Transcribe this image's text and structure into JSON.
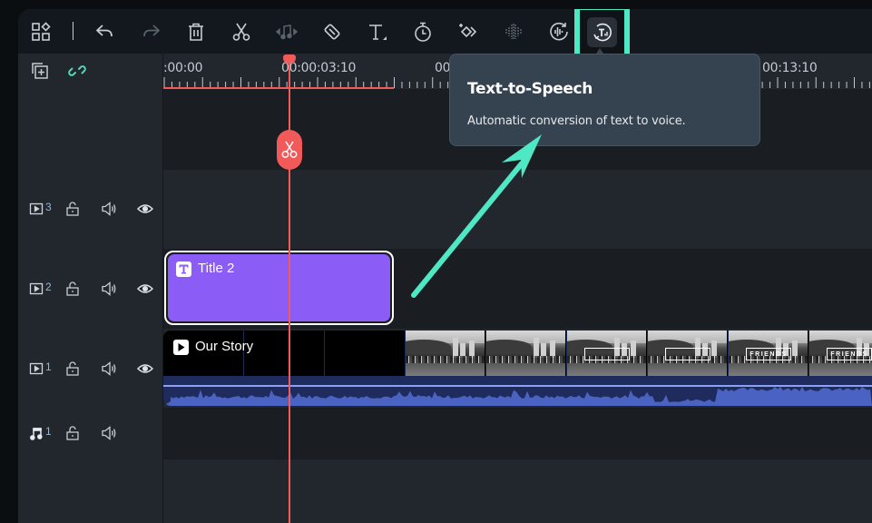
{
  "toolbar": {
    "buttons": [
      {
        "id": "layout",
        "icon": "layout-grid-icon",
        "label": "Layout"
      },
      {
        "id": "undo",
        "icon": "undo-icon",
        "label": "Undo"
      },
      {
        "id": "redo",
        "icon": "redo-icon",
        "label": "Redo",
        "disabled": true
      },
      {
        "id": "delete",
        "icon": "trash-icon",
        "label": "Delete"
      },
      {
        "id": "split",
        "icon": "scissors-icon",
        "label": "Split"
      },
      {
        "id": "audio-stretch",
        "icon": "audio-stretch-icon",
        "label": "Audio Stretch",
        "disabled": true
      },
      {
        "id": "crop",
        "icon": "crop-icon",
        "label": "Crop"
      },
      {
        "id": "text",
        "icon": "text-icon",
        "label": "Text"
      },
      {
        "id": "speed",
        "icon": "timer-icon",
        "label": "Speed"
      },
      {
        "id": "keyframe",
        "icon": "keyframe-icon",
        "label": "Keyframe"
      },
      {
        "id": "audio-detect",
        "icon": "waveform-icon",
        "label": "Silence Detection",
        "disabled": true
      },
      {
        "id": "audio-sync",
        "icon": "audio-sync-icon",
        "label": "Auto Sync"
      },
      {
        "id": "tts",
        "icon": "text-to-speech-icon",
        "label": "Text-to-Speech",
        "highlighted": true
      }
    ]
  },
  "timeline_header": {
    "add_track_icon": "add-track-icon",
    "link_icon": "link-icon"
  },
  "ruler": {
    "labels": [
      ":00:00",
      "00:00:03:10",
      "00",
      "00:13:10"
    ]
  },
  "playhead": {
    "time": "00:00:03:10",
    "color": "#f25a5a"
  },
  "tracks": [
    {
      "type": "video",
      "number": "3",
      "locked": false,
      "muted": false,
      "visible": true
    },
    {
      "type": "video",
      "number": "2",
      "locked": false,
      "muted": false,
      "visible": true
    },
    {
      "type": "video",
      "number": "1",
      "locked": false,
      "muted": false,
      "visible": true
    },
    {
      "type": "audio",
      "number": "1",
      "locked": false,
      "muted": false
    }
  ],
  "clips": {
    "title": {
      "label": "Title 2",
      "color": "#8b5cf6"
    },
    "video": {
      "label": "Our Story",
      "thumb_text": [
        "",
        "",
        "",
        "FRIENDS",
        "FRIENDS"
      ]
    }
  },
  "tooltip": {
    "title": "Text-to-Speech",
    "description": "Automatic conversion of text to voice."
  },
  "colors": {
    "accent": "#4fe8c5",
    "playhead": "#f25a5a",
    "title_clip": "#8b5cf6",
    "audio_wave": "#4a62c2"
  }
}
